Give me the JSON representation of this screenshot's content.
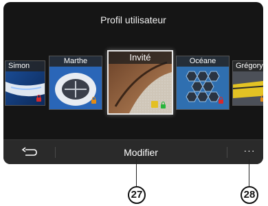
{
  "header": {
    "title": "Profil utilisateur"
  },
  "profiles": [
    {
      "name": "Simon"
    },
    {
      "name": "Marthe"
    },
    {
      "name": "Invité"
    },
    {
      "name": "Océane"
    },
    {
      "name": "Grégory"
    }
  ],
  "bottom_bar": {
    "modify_label": "Modifier",
    "more_label": "···"
  },
  "callouts": {
    "modify": "27",
    "more": "28"
  },
  "colors": {
    "lock_red": "#d8282a",
    "lock_orange": "#e38b14",
    "lock_green": "#27b53a",
    "edit_yellow": "#e3c024"
  }
}
